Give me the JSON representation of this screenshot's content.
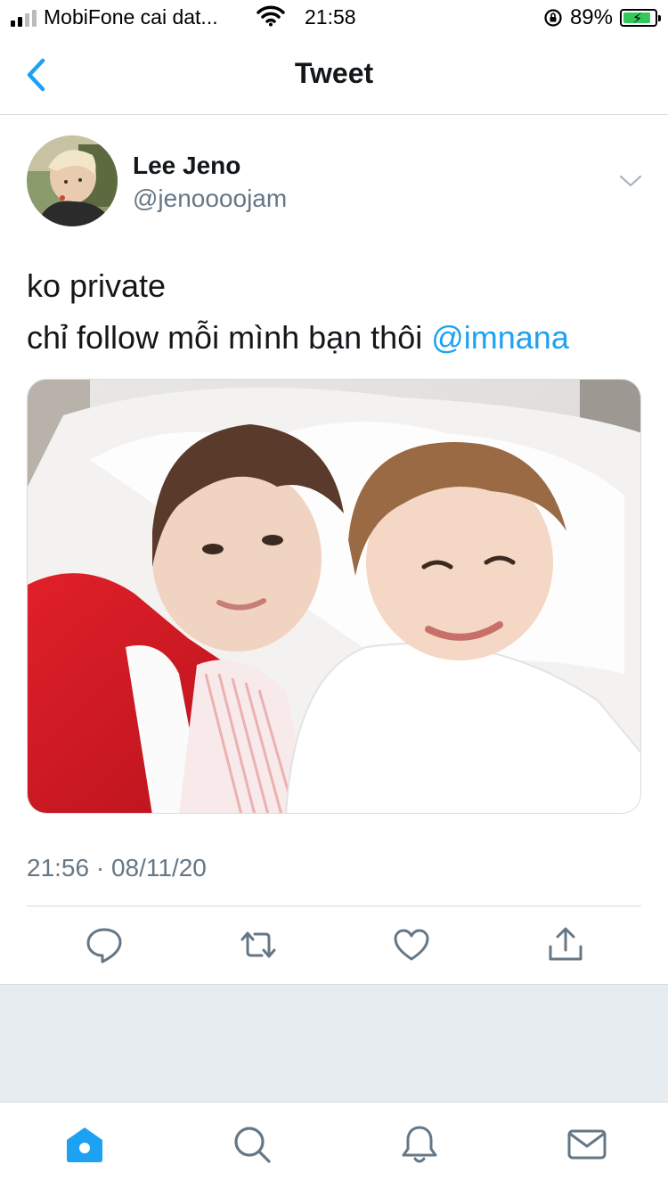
{
  "status_bar": {
    "carrier": "MobiFone cai dat...",
    "time": "21:58",
    "battery": "89%",
    "battery_level": 0.89
  },
  "nav": {
    "title": "Tweet",
    "back_icon": "chevron-left-icon"
  },
  "tweet": {
    "author_name": "Lee Jeno",
    "author_handle": "@jenoooojam",
    "text_line1": "ko private",
    "text_line2": "chỉ follow mỗi mình bạn thôi ",
    "mention": "@imnana",
    "timestamp": "21:56 · 08/11/20"
  },
  "actions": {
    "reply_icon": "reply-icon",
    "retweet_icon": "retweet-icon",
    "like_icon": "heart-icon",
    "share_icon": "share-icon"
  },
  "tab_bar": {
    "items": [
      "home-icon",
      "search-icon",
      "notifications-icon",
      "messages-icon"
    ]
  },
  "colors": {
    "accent": "#1da1f2",
    "secondary_text": "#657786",
    "divider": "#d8dde1",
    "gray_background": "#e6ecf0"
  }
}
